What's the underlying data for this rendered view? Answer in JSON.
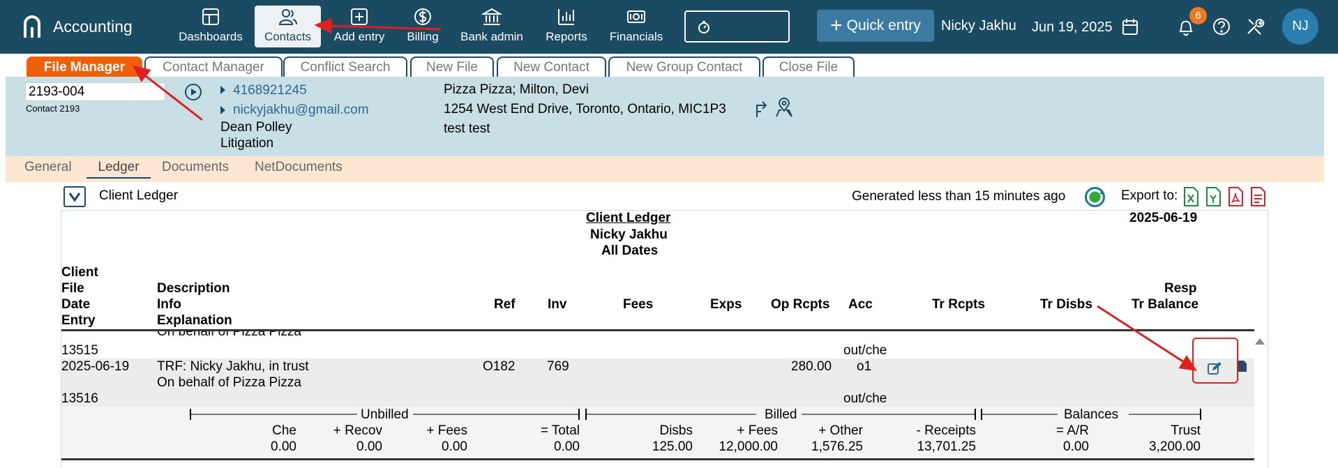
{
  "app": {
    "title": "Accounting"
  },
  "nav": {
    "items": [
      {
        "label": "Dashboards",
        "icon": "dashboard-icon"
      },
      {
        "label": "Contacts",
        "icon": "contacts-icon",
        "active": true
      },
      {
        "label": "Add entry",
        "icon": "add-entry-icon"
      },
      {
        "label": "Billing",
        "icon": "dollar-icon"
      },
      {
        "label": "Bank admin",
        "icon": "bank-icon"
      },
      {
        "label": "Reports",
        "icon": "bar-chart-icon"
      },
      {
        "label": "Financials",
        "icon": "money-icon"
      }
    ]
  },
  "header": {
    "quick_entry": "Quick entry",
    "user_name": "Nicky Jakhu",
    "date": "Jun 19, 2025",
    "notifications": "6",
    "avatar": "NJ"
  },
  "file_tabs": [
    "File Manager",
    "Contact Manager",
    "Conflict Search",
    "New File",
    "New Contact",
    "New Group Contact",
    "Close File"
  ],
  "file_info": {
    "file_number": "2193-004",
    "contact_label": "Contact 2193",
    "phone": "4168921245",
    "email": "nickyjakhu@gmail.com",
    "lawyer": "Dean Polley",
    "practice": "Litigation",
    "client": "Pizza Pizza; Milton, Devi",
    "address": "1254 West End Drive, Toronto, Ontario, MIC1P3",
    "note": "test test"
  },
  "sub_tabs": [
    "General",
    "Ledger",
    "Documents",
    "NetDocuments"
  ],
  "ledger_bar": {
    "title": "Client Ledger",
    "generated": "Generated less than 15 minutes ago",
    "export_label": "Export to:"
  },
  "report": {
    "title": "Client Ledger",
    "name": "Nicky Jakhu",
    "range": "All Dates",
    "date": "2025-06-19",
    "col_client": [
      "Client",
      "File",
      "Date",
      "Entry"
    ],
    "col_desc": [
      "Description",
      "Info",
      "Explanation"
    ],
    "col_ref": "Ref",
    "col_inv": "Inv",
    "col_fees": "Fees",
    "col_exps": "Exps",
    "col_op": "Op Rcpts",
    "col_acc": "Acc",
    "col_trr": "Tr Rcpts",
    "col_trd": "Tr Disbs",
    "col_resp": "Resp",
    "col_trbal": "Tr Balance",
    "row0": {
      "desc2": "On behalf of Pizza Pizza",
      "entry": "13515",
      "acc": "out/che"
    },
    "row1": {
      "date": "2025-06-19",
      "desc": "TRF: Nicky Jakhu, in trust",
      "desc2": "On behalf of Pizza Pizza",
      "entry": "13516",
      "ref": "O182",
      "inv": "769",
      "op": "280.00",
      "acc": "o1",
      "acc2": "out/che"
    },
    "summary": {
      "unbilled": "Unbilled",
      "billed": "Billed",
      "balances": "Balances",
      "labels": [
        "Che",
        "+ Recov",
        "+ Fees",
        "= Total",
        "Disbs",
        "+ Fees",
        "+ Other",
        "- Receipts",
        "= A/R",
        "Trust"
      ],
      "values": [
        "0.00",
        "0.00",
        "0.00",
        "0.00",
        "125.00",
        "12,000.00",
        "1,576.25",
        "13,701.25",
        "0.00",
        "3,200.00"
      ]
    }
  },
  "colors": {
    "topbar": "#1b4a63",
    "accent": "#f0600a",
    "info_panel": "#c8dfe5",
    "subtabs_bg": "#fde7d3",
    "annotation": "#e02020"
  }
}
